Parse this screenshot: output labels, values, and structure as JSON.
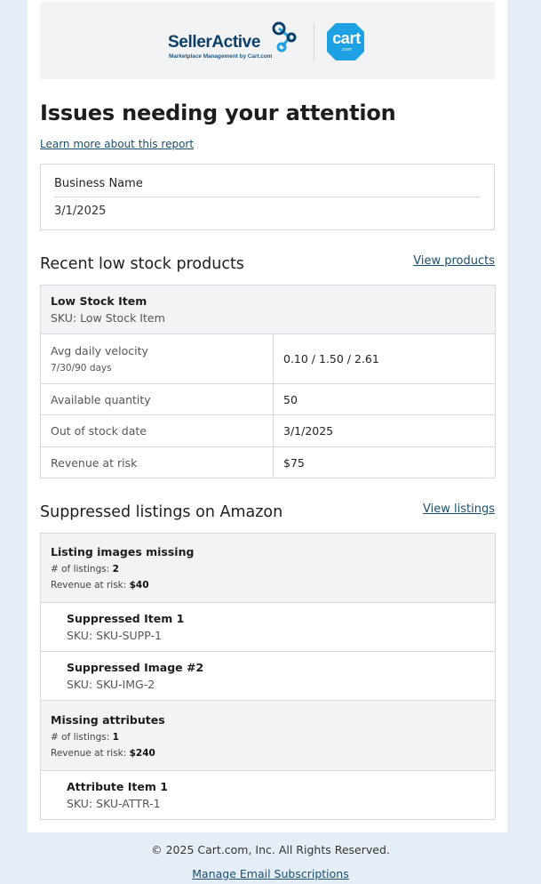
{
  "brand": {
    "selleractive_wordmark": "SellerActive",
    "selleractive_tagline": "Marketplace Management by Cart.com",
    "cart_wordmark": "cart",
    "cart_domain": ".com",
    "colors": {
      "navy": "#0d3e66",
      "cart_blue": "#1da1e3",
      "link": "#1b4e6e"
    }
  },
  "header": {
    "title": "Issues needing your attention",
    "learn_more": "Learn more about this report"
  },
  "business": {
    "label": "Business Name",
    "date": "3/1/2025"
  },
  "low_stock": {
    "title": "Recent low stock products",
    "link": "View products",
    "item": {
      "name": "Low Stock Item",
      "sku": "SKU: Low Stock Item"
    },
    "rows": [
      {
        "label": "Avg daily velocity",
        "sublabel": "7/30/90 days",
        "value": "0.10 / 1.50 / 2.61"
      },
      {
        "label": "Available quantity",
        "value": "50"
      },
      {
        "label": "Out of stock date",
        "value": "3/1/2025"
      },
      {
        "label": "Revenue at risk",
        "value": "$75"
      }
    ]
  },
  "suppressed": {
    "title": "Suppressed listings on Amazon",
    "link": "View listings",
    "groups": [
      {
        "name": "Listing images missing",
        "count_label": "# of listings:",
        "count": "2",
        "revenue_label": "Revenue at risk:",
        "revenue": "$40",
        "items": [
          {
            "name": "Suppressed Item 1",
            "sku": "SKU: SKU-SUPP-1"
          },
          {
            "name": "Suppressed Image #2",
            "sku": "SKU: SKU-IMG-2"
          }
        ]
      },
      {
        "name": "Missing attributes",
        "count_label": "# of listings:",
        "count": "1",
        "revenue_label": "Revenue at risk:",
        "revenue": "$240",
        "items": [
          {
            "name": "Attribute Item 1",
            "sku": "SKU: SKU-ATTR-1"
          }
        ]
      }
    ]
  },
  "footer": {
    "copyright": "© 2025 Cart.com, Inc. All Rights Reserved.",
    "manage": "Manage Email Subscriptions"
  }
}
